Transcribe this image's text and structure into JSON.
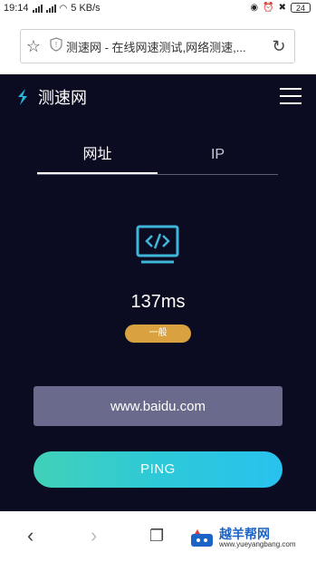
{
  "status_bar": {
    "time": "19:14",
    "speed": "5 KB/s",
    "battery": "24"
  },
  "browser": {
    "url_text": "测速网 - 在线网速测试,网络测速,..."
  },
  "site": {
    "logo_text": "测速网",
    "tabs": [
      {
        "label": "网址"
      },
      {
        "label": "IP"
      }
    ],
    "result_value": "137ms",
    "quality_badge": "一般",
    "url_input": "www.baidu.com",
    "ping_label": "PING"
  },
  "watermark": {
    "title": "越羊帮网",
    "subtitle": "www.yueyangbang.com"
  },
  "colors": {
    "site_bg": "#0b0c22",
    "badge": "#d9a13f",
    "input_bg": "#6a6a8c",
    "ping_gradient_start": "#41d1b8",
    "ping_gradient_end": "#28c2ee",
    "logo_accent": "#27b7e0"
  }
}
